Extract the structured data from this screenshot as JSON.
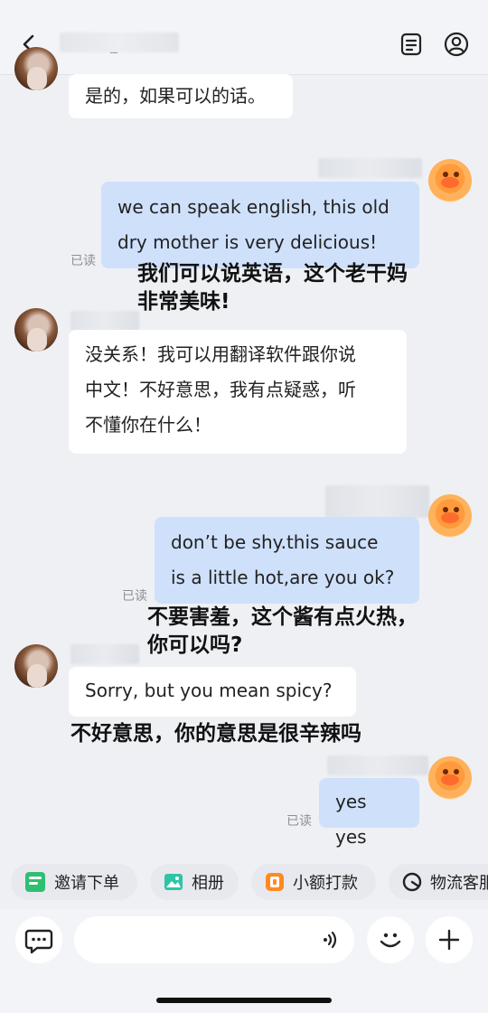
{
  "header": {
    "title": "_"
  },
  "messages": [
    {
      "side": "in",
      "text_lines": [
        "是的，如果可以的话。"
      ]
    },
    {
      "side": "out",
      "text_lines": [
        "we can speak english, this old",
        "dry mother is very delicious!"
      ],
      "status": "已读",
      "overlay_lines": [
        "我们可以说英语，这个老干妈",
        "非常美味!"
      ]
    },
    {
      "side": "in",
      "text_lines": [
        "没关系！我可以用翻译软件跟你说",
        "中文！不好意思，我有点疑惑，听",
        "不懂你在什么！"
      ]
    },
    {
      "side": "out",
      "text_lines": [
        "don’t be shy.this sauce",
        "is a little hot,are you ok?"
      ],
      "status": "已读",
      "overlay_lines": [
        "不要害羞，这个酱有点火热，",
        "你可以吗?"
      ]
    },
    {
      "side": "in",
      "text_lines": [
        "Sorry, but you mean spicy?"
      ],
      "overlay_lines": [
        "不好意思，你的意思是很辛辣吗"
      ]
    },
    {
      "side": "out",
      "text_lines": [
        "yes yes"
      ],
      "status": "已读"
    }
  ],
  "quick_actions": [
    "邀请下单",
    "相册",
    "小额打款",
    "物流客服"
  ],
  "colors": {
    "outgoing_bubble": "#cfe0fb",
    "incoming_bubble": "#ffffff",
    "background": "#eef0f4"
  },
  "icons": {
    "back": "chevron-left-icon",
    "notes": "document-list-icon",
    "profile": "user-circle-icon"
  }
}
